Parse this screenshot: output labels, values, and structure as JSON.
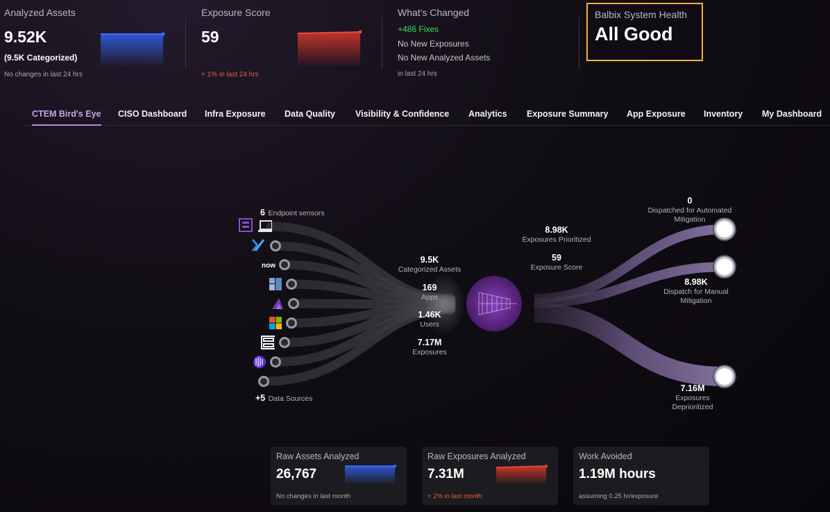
{
  "kpis": {
    "analyzed": {
      "label": "Analyzed Assets",
      "value": "9.52K",
      "sub": "(9.5K Categorized)",
      "foot": "No changes in last 24 hrs"
    },
    "exposure": {
      "label": "Exposure Score",
      "value": "59",
      "foot": "+ 1% in last 24 hrs"
    },
    "changed": {
      "label": "What's Changed",
      "fixes": "+486 Fixes",
      "exposures": "No New Exposures",
      "assets": "No New Analyzed Assets",
      "foot": "in last 24 hrs"
    },
    "health": {
      "label": "Balbix System Health",
      "value": "All Good"
    }
  },
  "tabs": [
    "CTEM Bird's Eye",
    "CISO Dashboard",
    "Infra Exposure",
    "Data Quality",
    "Visibility & Confidence",
    "Analytics",
    "Exposure Summary",
    "App Exposure",
    "Inventory",
    "My Dashboard"
  ],
  "active_tab": 0,
  "flow": {
    "sources": {
      "sensors_count": "6",
      "sensors_label": "Endpoint sensors",
      "more_count": "+5",
      "more_label": "Data Sources",
      "now_logo": "now"
    },
    "middle": [
      {
        "num": "9.5K",
        "label": "Categorized Assets"
      },
      {
        "num": "169",
        "label": "Apps"
      },
      {
        "num": "1.46K",
        "label": "Users"
      },
      {
        "num": "7.17M",
        "label": "Exposures"
      }
    ],
    "prioritized": {
      "num": "8.98K",
      "label": "Exposures Prioritized"
    },
    "score": {
      "num": "59",
      "label": "Exposure Score"
    },
    "outputs": [
      {
        "num": "0",
        "label1": "Dispatched for Automated",
        "label2": "Mitigation"
      },
      {
        "num": "8.98K",
        "label1": "Dispatch for Manual",
        "label2": "Mitigation"
      },
      {
        "num": "7.16M",
        "label1": "Exposures",
        "label2": "Deprioritized"
      }
    ]
  },
  "cards": {
    "raw_assets": {
      "title": "Raw Assets Analyzed",
      "value": "26,767",
      "foot": "No changes in last month"
    },
    "raw_exposures": {
      "title": "Raw Exposures Analyzed",
      "value": "7.31M",
      "foot": "+ 2% in last month"
    },
    "work_avoided": {
      "title": "Work Avoided",
      "value": "1.19M hours",
      "foot": "assuming 0.25 hr/exposure"
    }
  },
  "colors": {
    "accent": "#b98ae6",
    "health_border": "#f2b233",
    "positive": "#3ddc59",
    "negative": "#ef5a48",
    "blue": "#2f5bd8",
    "red": "#c9352a"
  }
}
